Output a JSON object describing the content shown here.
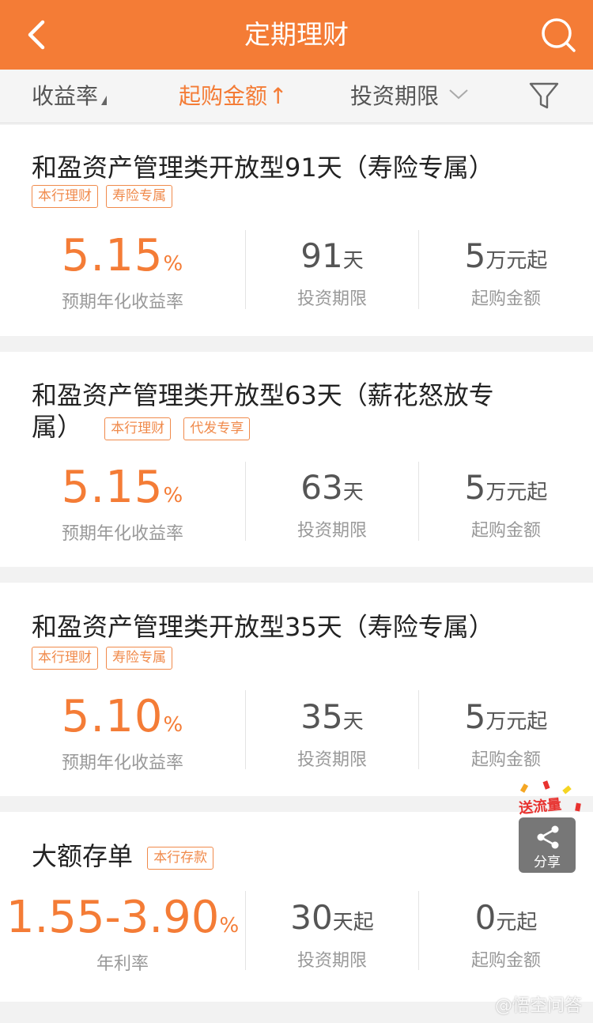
{
  "header": {
    "title": "定期理财",
    "back_icon": "chevron-left-icon",
    "search_icon": "search-icon"
  },
  "filters": {
    "rate": "收益率",
    "amount": "起购金额",
    "amount_arrow": "↑",
    "period": "投资期限",
    "filter_icon": "funnel-icon"
  },
  "products": [
    {
      "title": "和盈资产管理类开放型91天（寿险专属）",
      "tags": [
        "本行理财",
        "寿险专属"
      ],
      "rate": "5.15",
      "rate_unit": "%",
      "rate_caption": "预期年化收益率",
      "period_value": "91",
      "period_unit": "天",
      "period_caption": "投资期限",
      "amount_value": "5",
      "amount_unit": "万元起",
      "amount_caption": "起购金额"
    },
    {
      "title_line1": "和盈资产管理类开放型63天（薪花怒放专",
      "title_line2": "属）",
      "tags": [
        "本行理财",
        "代发专享"
      ],
      "rate": "5.15",
      "rate_unit": "%",
      "rate_caption": "预期年化收益率",
      "period_value": "63",
      "period_unit": "天",
      "period_caption": "投资期限",
      "amount_value": "5",
      "amount_unit": "万元起",
      "amount_caption": "起购金额"
    },
    {
      "title": "和盈资产管理类开放型35天（寿险专属）",
      "tags": [
        "本行理财",
        "寿险专属"
      ],
      "rate": "5.10",
      "rate_unit": "%",
      "rate_caption": "预期年化收益率",
      "period_value": "35",
      "period_unit": "天",
      "period_caption": "投资期限",
      "amount_value": "5",
      "amount_unit": "万元起",
      "amount_caption": "起购金额"
    },
    {
      "title": "大额存单",
      "tags": [
        "本行存款"
      ],
      "rate": "1.55-3.90",
      "rate_unit": "%",
      "rate_caption": "年利率",
      "period_value": "30",
      "period_unit": "天起",
      "period_caption": "投资期限",
      "amount_value": "0",
      "amount_unit": "元起",
      "amount_caption": "起购金额"
    }
  ],
  "share": {
    "promo": "送流量",
    "label": "分享"
  },
  "watermark": "@悟空问答",
  "colors": {
    "accent": "#f47c36",
    "header_bg": "#f47c36",
    "tag_border": "#f08a4b"
  }
}
